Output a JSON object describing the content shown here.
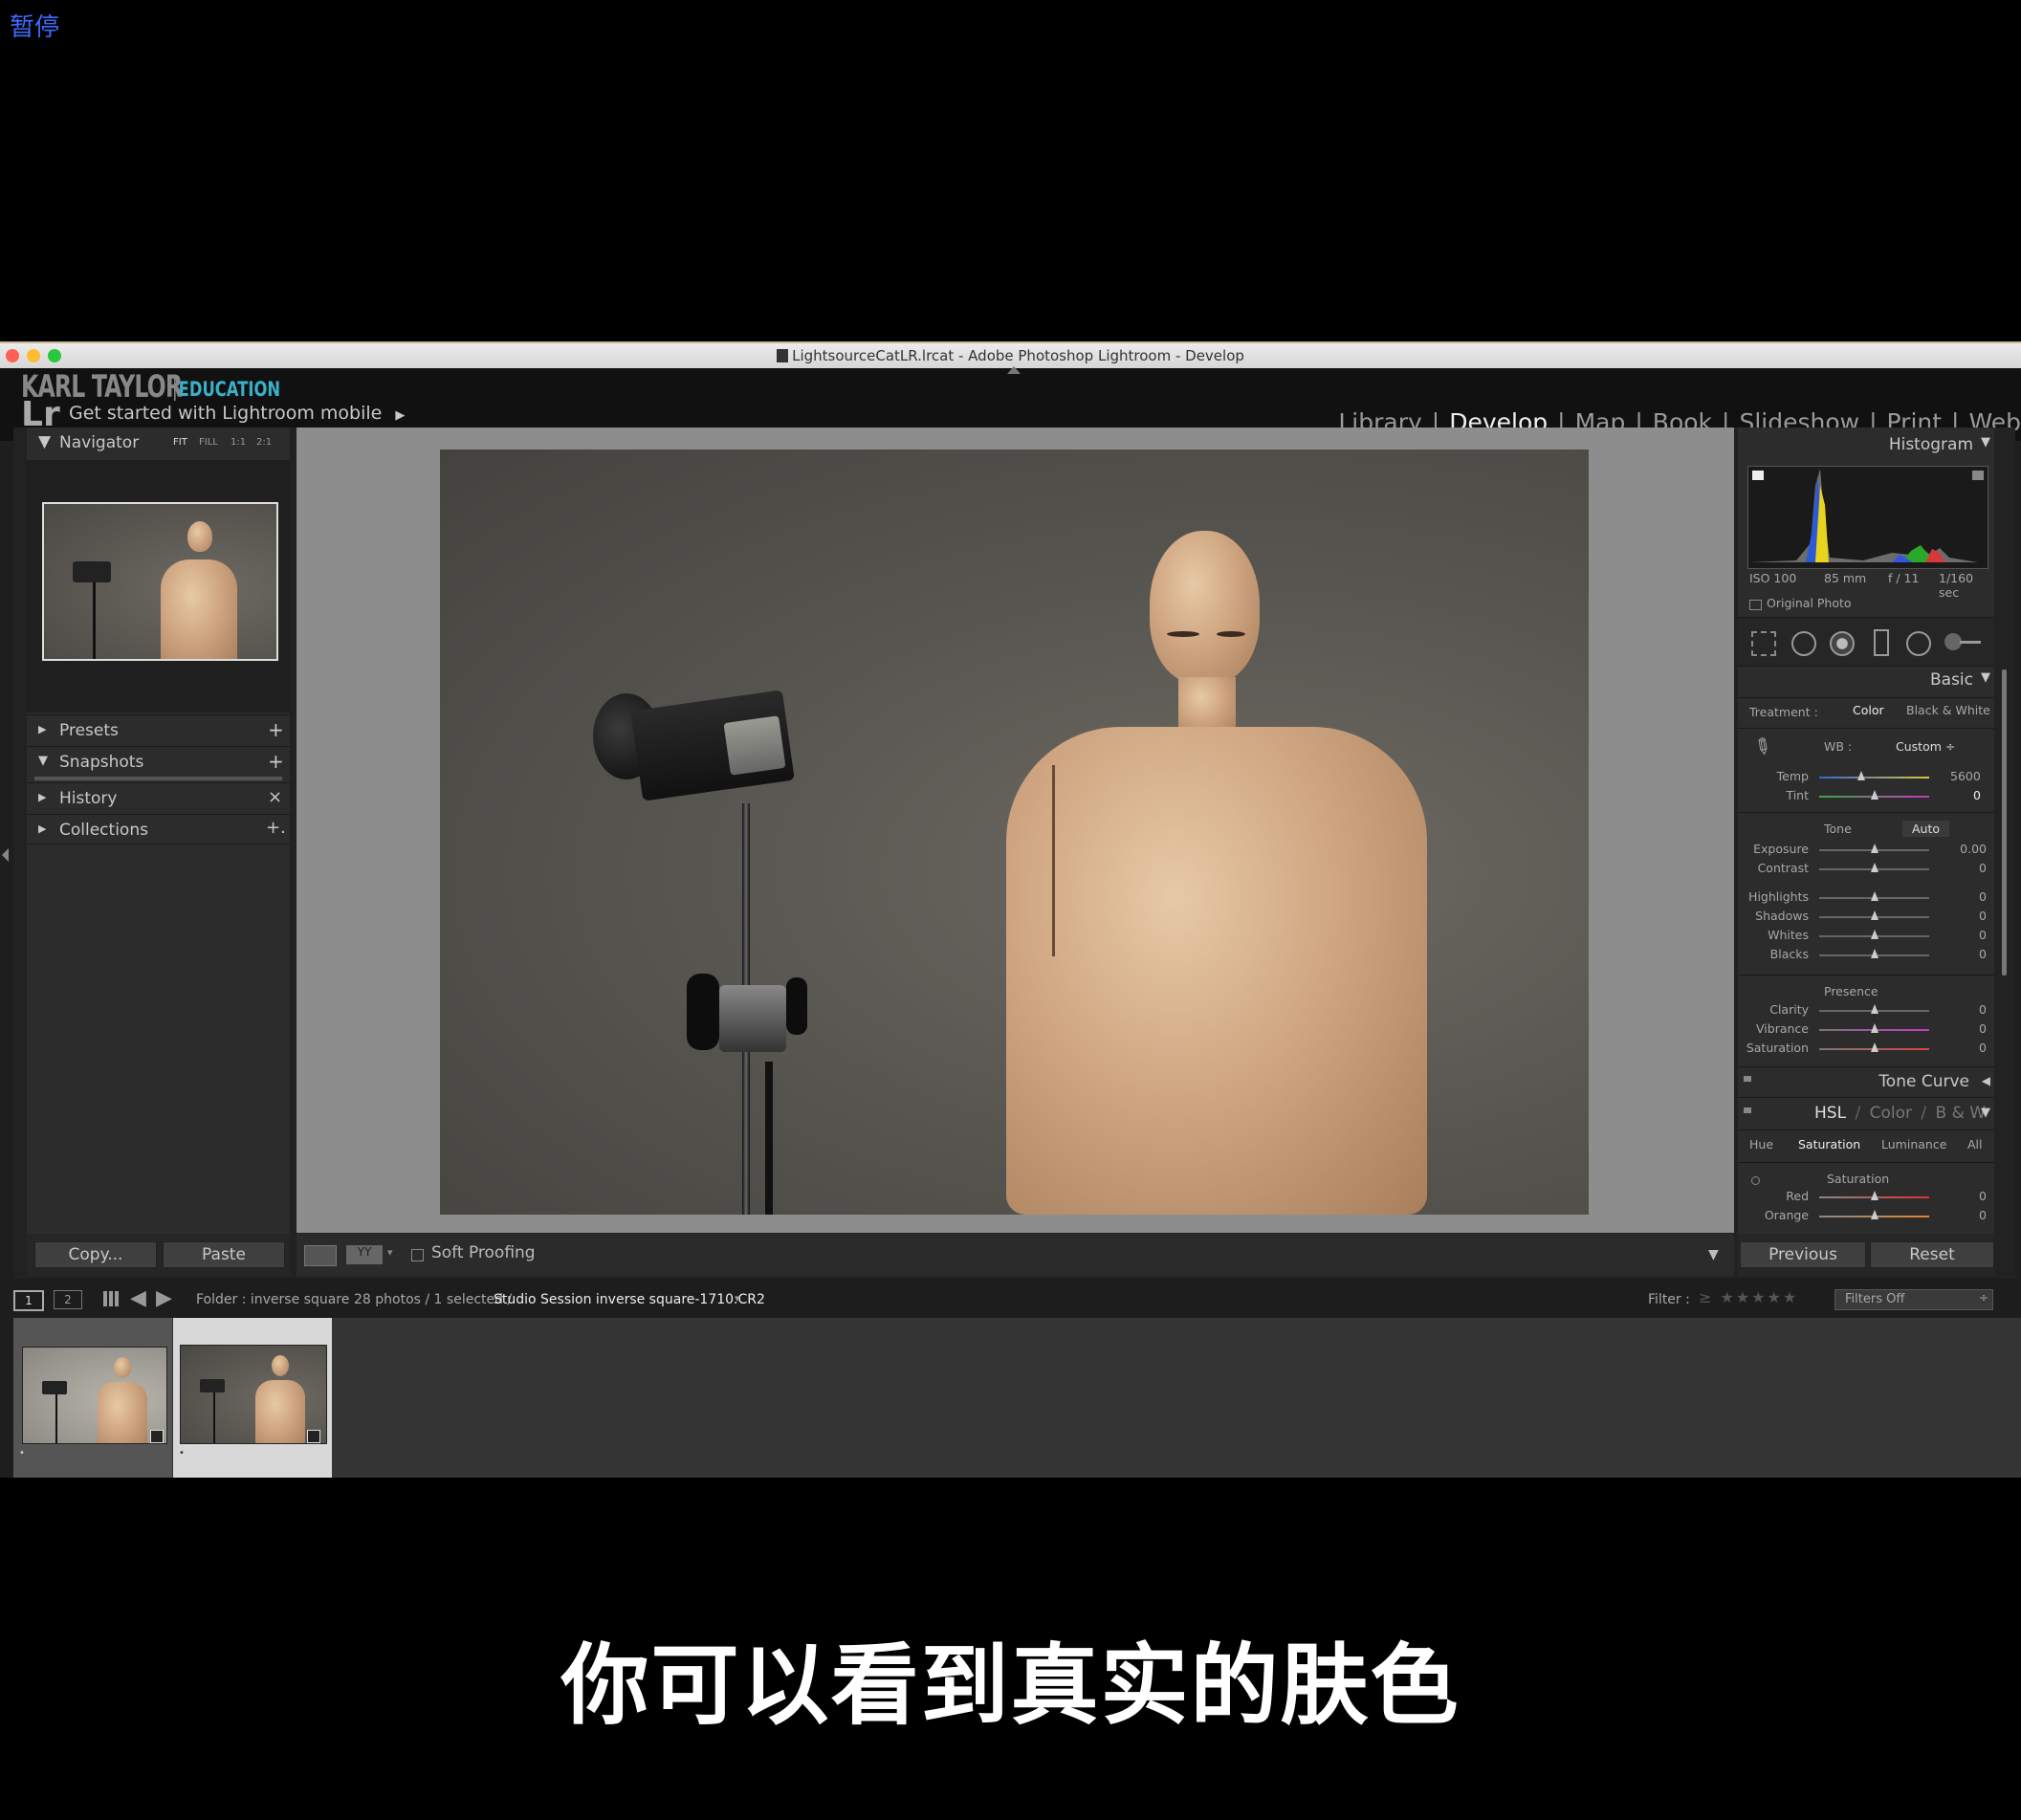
{
  "overlay": {
    "pause_label": "暂停",
    "subtitle": "你可以看到真实的肤色"
  },
  "window": {
    "title": "LightsourceCatLR.lrcat - Adobe Photoshop Lightroom - Develop"
  },
  "header": {
    "brand_name": "KARL TAYLOR",
    "brand_sub": "EDUCATION",
    "lr_mark": "Lr",
    "mobile_text": "Get started with Lightroom mobile",
    "modules": [
      "Library",
      "Develop",
      "Map",
      "Book",
      "Slideshow",
      "Print",
      "Web"
    ],
    "active_module": "Develop"
  },
  "left_panel": {
    "navigator": {
      "title": "Navigator",
      "zoom_options": [
        "FIT",
        "FILL",
        "1:1",
        "2:1"
      ]
    },
    "sections": [
      {
        "label": "Presets",
        "action": "+"
      },
      {
        "label": "Snapshots",
        "action": "+"
      },
      {
        "label": "History",
        "action": "×"
      },
      {
        "label": "Collections",
        "action": "+."
      }
    ],
    "copy_label": "Copy...",
    "paste_label": "Paste"
  },
  "center_toolbar": {
    "soft_proofing_label": "Soft Proofing"
  },
  "right_panel": {
    "histogram": {
      "title": "Histogram",
      "iso": "ISO 100",
      "focal": "85 mm",
      "aperture": "f / 11",
      "shutter": "1/160 sec",
      "original_photo": "Original Photo"
    },
    "basic": {
      "title": "Basic",
      "treatment_label": "Treatment :",
      "treatment_options": [
        "Color",
        "Black & White"
      ],
      "wb_label": "WB :",
      "wb_value": "Custom",
      "temp": {
        "label": "Temp",
        "value": "5600"
      },
      "tint": {
        "label": "Tint",
        "value": "0"
      },
      "tone_label": "Tone",
      "auto_label": "Auto",
      "tone_sliders": [
        {
          "label": "Exposure",
          "value": "0.00"
        },
        {
          "label": "Contrast",
          "value": "0"
        },
        {
          "label": "Highlights",
          "value": "0"
        },
        {
          "label": "Shadows",
          "value": "0"
        },
        {
          "label": "Whites",
          "value": "0"
        },
        {
          "label": "Blacks",
          "value": "0"
        }
      ],
      "presence_label": "Presence",
      "presence_sliders": [
        {
          "label": "Clarity",
          "value": "0"
        },
        {
          "label": "Vibrance",
          "value": "0"
        },
        {
          "label": "Saturation",
          "value": "0"
        }
      ]
    },
    "tone_curve": {
      "title": "Tone Curve"
    },
    "hsl": {
      "title_hsl": "HSL",
      "title_color": "Color",
      "title_bw": "B & W",
      "tabs": [
        "Hue",
        "Saturation",
        "Luminance",
        "All"
      ],
      "active_tab": "Saturation",
      "section_label": "Saturation",
      "sliders": [
        {
          "label": "Red",
          "value": "0"
        },
        {
          "label": "Orange",
          "value": "0"
        }
      ]
    },
    "previous_label": "Previous",
    "reset_label": "Reset"
  },
  "filmstrip_bar": {
    "page1": "1",
    "page2": "2",
    "folder_text": "Folder : inverse square",
    "count_text": "28 photos / 1 selected /",
    "file_name": "Studio Session inverse square-1710.CR2",
    "filter_label": "Filter :",
    "filter_value": "Filters Off"
  },
  "colors": {
    "accent_brand": "#3bb0c9",
    "pause_blue": "#3d6cff",
    "panel_bg": "#2c2c2c",
    "workspace_gray": "#8d8d8d"
  }
}
